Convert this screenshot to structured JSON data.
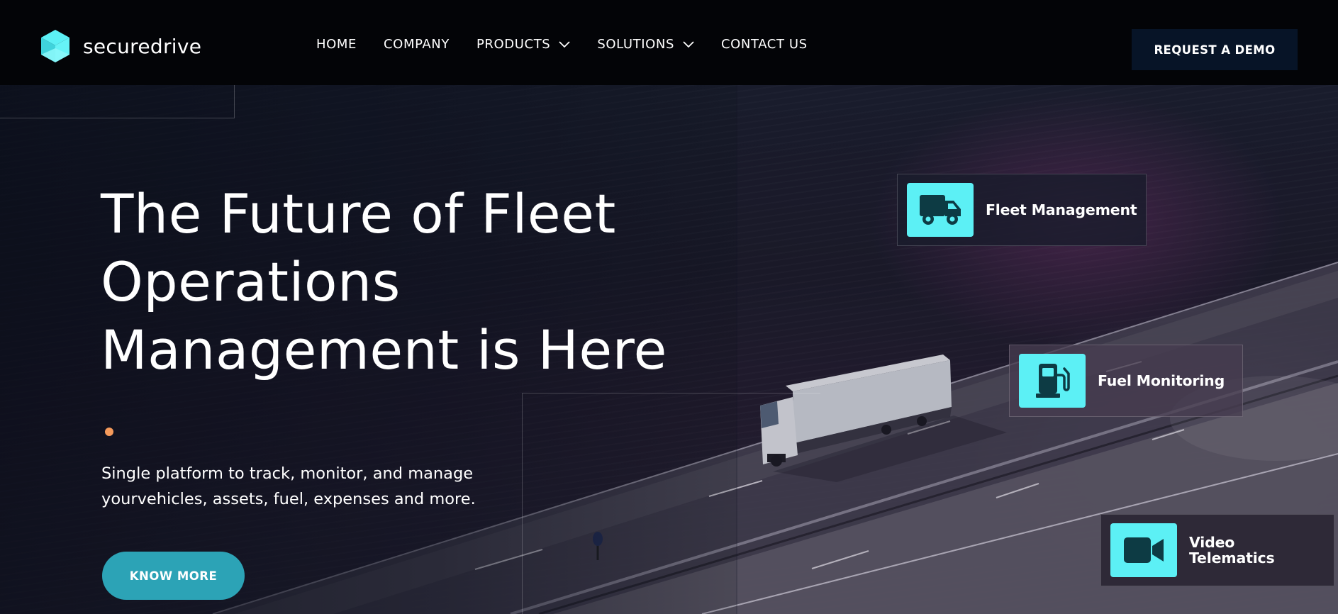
{
  "brand": {
    "name": "securedrive",
    "accent": "#5cf0f5",
    "dark": "#071427"
  },
  "nav": {
    "items": [
      {
        "label": "HOME",
        "has_dropdown": false
      },
      {
        "label": "COMPANY",
        "has_dropdown": false
      },
      {
        "label": "PRODUCTS",
        "has_dropdown": true
      },
      {
        "label": "SOLUTIONS",
        "has_dropdown": true
      },
      {
        "label": "CONTACT US",
        "has_dropdown": false
      }
    ],
    "cta_label": "REQUEST A DEMO"
  },
  "hero": {
    "title": "The Future of Fleet Operations Management is Here",
    "subtitle": "Single platform to track, monitor, and manage yourvehicles, assets, fuel, expenses and more.",
    "button_label": "KNOW MORE",
    "button_color": "#2ca3b6",
    "dot_color": "#f59a5b"
  },
  "features": [
    {
      "label": "Fleet Management",
      "icon": "truck-icon"
    },
    {
      "label": "Fuel Monitoring",
      "icon": "fuel-pump-icon"
    },
    {
      "label": "Video Telematics",
      "icon": "video-camera-icon"
    }
  ]
}
